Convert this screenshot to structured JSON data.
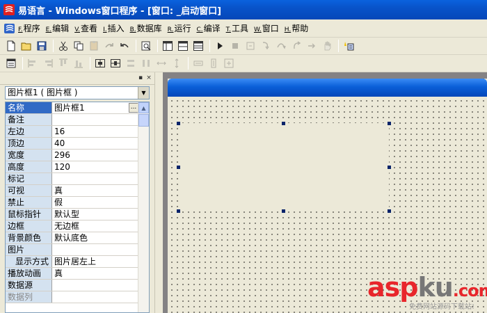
{
  "titlebar": {
    "title": "易语言 - Windows窗口程序 - [窗口: _启动窗口]"
  },
  "menu": [
    {
      "key": "F.",
      "label": "程序"
    },
    {
      "key": "E.",
      "label": "编辑"
    },
    {
      "key": "V.",
      "label": "查看"
    },
    {
      "key": "I.",
      "label": "插入"
    },
    {
      "key": "B.",
      "label": "数据库"
    },
    {
      "key": "R.",
      "label": "运行"
    },
    {
      "key": "C.",
      "label": "编译"
    },
    {
      "key": "T.",
      "label": "工具"
    },
    {
      "key": "W.",
      "label": "窗口"
    },
    {
      "key": "H.",
      "label": "帮助"
    }
  ],
  "panel": {
    "close_glyph": "×",
    "pin_glyph": "▪",
    "selector": "图片框1 ( 图片框 )",
    "properties": [
      {
        "name": "名称",
        "value": "图片框1"
      },
      {
        "name": "备注",
        "value": ""
      },
      {
        "name": "左边",
        "value": "16"
      },
      {
        "name": "顶边",
        "value": "40"
      },
      {
        "name": "宽度",
        "value": "296"
      },
      {
        "name": "高度",
        "value": "120"
      },
      {
        "name": "标记",
        "value": ""
      },
      {
        "name": "可视",
        "value": "真"
      },
      {
        "name": "禁止",
        "value": "假"
      },
      {
        "name": "鼠标指针",
        "value": "默认型"
      },
      {
        "name": "边框",
        "value": "无边框"
      },
      {
        "name": "背景颜色",
        "value": "默认底色"
      },
      {
        "name": "图片",
        "value": ""
      },
      {
        "name": "显示方式",
        "value": "图片居左上"
      },
      {
        "name": "播放动画",
        "value": "真"
      },
      {
        "name": "数据源",
        "value": ""
      },
      {
        "name": "数据列",
        "value": ""
      }
    ],
    "ellipsis": "..."
  },
  "watermark": {
    "asp": "asp",
    "ku": "ku",
    "com": ".com",
    "sub": "免费网站源码下载站!"
  },
  "colors": {
    "titlebar": "#0054e3",
    "selection": "#316ac5",
    "handle": "#0a246a",
    "watermark_red": "#e8262b"
  }
}
